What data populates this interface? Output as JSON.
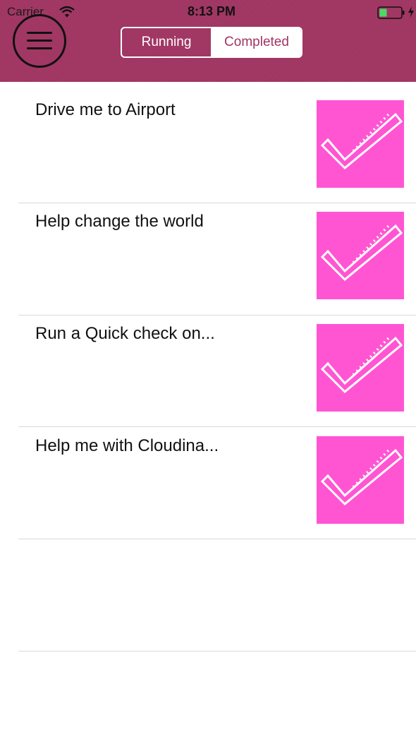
{
  "status_bar": {
    "carrier": "Carrier",
    "time": "8:13 PM",
    "wifi_icon": "wifi-icon",
    "battery_icon": "battery-icon",
    "charge_icon": "charging-bolt-icon"
  },
  "header": {
    "background_color": "#a03562",
    "menu_icon": "hamburger-menu-icon",
    "segments": [
      {
        "label": "Running",
        "selected": false
      },
      {
        "label": "Completed",
        "selected": true
      }
    ]
  },
  "tasks": [
    {
      "title": "Drive me to Airport",
      "status_icon": "checkmark-icon"
    },
    {
      "title": "Help change the world",
      "status_icon": "checkmark-icon"
    },
    {
      "title": "Run a Quick check on...",
      "status_icon": "checkmark-icon"
    },
    {
      "title": "Help me with Cloudina...",
      "status_icon": "checkmark-icon"
    }
  ],
  "colors": {
    "accent": "#a03562",
    "check_tile": "#ff55d3",
    "separator": "#d9d9d9"
  }
}
